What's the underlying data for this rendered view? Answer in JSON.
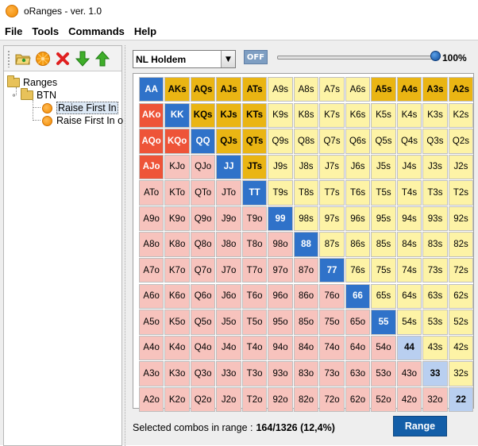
{
  "window": {
    "title": "oRanges - ver. 1.0"
  },
  "menu": [
    "File",
    "Tools",
    "Commands",
    "Help"
  ],
  "toolbar": {
    "icons": [
      "open-folder-icon",
      "orange-icon",
      "delete-icon",
      "move-down-icon",
      "move-up-icon"
    ]
  },
  "tree": {
    "root": "Ranges",
    "group": "BTN",
    "items": [
      "Raise First In",
      "Raise First In o"
    ]
  },
  "controls": {
    "game": "NL Holdem",
    "toggle": "OFF",
    "slider_percent": 100,
    "slider_label": "100%"
  },
  "colors": {
    "gold": "#eab513",
    "red": "#ee5438",
    "blue": "#2f72c9",
    "light_blue": "#b9cff0",
    "light_yellow": "#fdf3a6",
    "light_pink": "#f7c3bd",
    "range_button": "#135ea8"
  },
  "hands": [
    [
      "AA",
      "AKs",
      "AQs",
      "AJs",
      "ATs",
      "A9s",
      "A8s",
      "A7s",
      "A6s",
      "A5s",
      "A4s",
      "A3s",
      "A2s"
    ],
    [
      "AKo",
      "KK",
      "KQs",
      "KJs",
      "KTs",
      "K9s",
      "K8s",
      "K7s",
      "K6s",
      "K5s",
      "K4s",
      "K3s",
      "K2s"
    ],
    [
      "AQo",
      "KQo",
      "QQ",
      "QJs",
      "QTs",
      "Q9s",
      "Q8s",
      "Q7s",
      "Q6s",
      "Q5s",
      "Q4s",
      "Q3s",
      "Q2s"
    ],
    [
      "AJo",
      "KJo",
      "QJo",
      "JJ",
      "JTs",
      "J9s",
      "J8s",
      "J7s",
      "J6s",
      "J5s",
      "J4s",
      "J3s",
      "J2s"
    ],
    [
      "ATo",
      "KTo",
      "QTo",
      "JTo",
      "TT",
      "T9s",
      "T8s",
      "T7s",
      "T6s",
      "T5s",
      "T4s",
      "T3s",
      "T2s"
    ],
    [
      "A9o",
      "K9o",
      "Q9o",
      "J9o",
      "T9o",
      "99",
      "98s",
      "97s",
      "96s",
      "95s",
      "94s",
      "93s",
      "92s"
    ],
    [
      "A8o",
      "K8o",
      "Q8o",
      "J8o",
      "T8o",
      "98o",
      "88",
      "87s",
      "86s",
      "85s",
      "84s",
      "83s",
      "82s"
    ],
    [
      "A7o",
      "K7o",
      "Q7o",
      "J7o",
      "T7o",
      "97o",
      "87o",
      "77",
      "76s",
      "75s",
      "74s",
      "73s",
      "72s"
    ],
    [
      "A6o",
      "K6o",
      "Q6o",
      "J6o",
      "T6o",
      "96o",
      "86o",
      "76o",
      "66",
      "65s",
      "64s",
      "63s",
      "62s"
    ],
    [
      "A5o",
      "K5o",
      "Q5o",
      "J5o",
      "T5o",
      "95o",
      "85o",
      "75o",
      "65o",
      "55",
      "54s",
      "53s",
      "52s"
    ],
    [
      "A4o",
      "K4o",
      "Q4o",
      "J4o",
      "T4o",
      "94o",
      "84o",
      "74o",
      "64o",
      "54o",
      "44",
      "43s",
      "42s"
    ],
    [
      "A3o",
      "K3o",
      "Q3o",
      "J3o",
      "T3o",
      "93o",
      "83o",
      "73o",
      "63o",
      "53o",
      "43o",
      "33",
      "32s"
    ],
    [
      "A2o",
      "K2o",
      "Q2o",
      "J2o",
      "T2o",
      "92o",
      "82o",
      "72o",
      "62o",
      "52o",
      "42o",
      "32o",
      "22"
    ]
  ],
  "highlighted": {
    "gold": [
      "AKs",
      "AQs",
      "AJs",
      "ATs",
      "A5s",
      "A4s",
      "A3s",
      "A2s",
      "KQs",
      "KJs",
      "KTs",
      "QJs",
      "QTs",
      "JTs"
    ],
    "red": [
      "AKo",
      "AQo",
      "KQo",
      "AJo"
    ],
    "blue": [
      "AA",
      "KK",
      "QQ",
      "JJ",
      "TT",
      "99",
      "88",
      "77",
      "66",
      "55"
    ],
    "light_blue": [
      "44",
      "33",
      "22"
    ]
  },
  "status": {
    "label": "Selected combos in range :",
    "value": "164/1326 (12,4%)"
  },
  "range_button": "Range"
}
